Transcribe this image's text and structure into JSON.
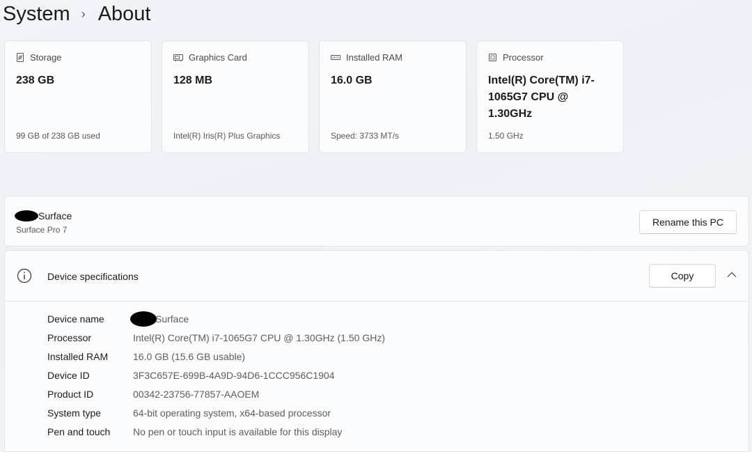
{
  "breadcrumb": {
    "parent": "System",
    "separator": "›",
    "current": "About"
  },
  "cards": [
    {
      "icon": "storage-icon",
      "label": "Storage",
      "value": "238 GB",
      "sub": "99 GB of 238 GB used"
    },
    {
      "icon": "graphics-card-icon",
      "label": "Graphics Card",
      "value": "128 MB",
      "sub": "Intel(R) Iris(R) Plus Graphics"
    },
    {
      "icon": "ram-icon",
      "label": "Installed RAM",
      "value": "16.0 GB",
      "sub": "Speed: 3733 MT/s"
    },
    {
      "icon": "processor-icon",
      "label": "Processor",
      "value": "Intel(R) Core(TM) i7-1065G7 CPU @ 1.30GHz",
      "sub": "1.50 GHz"
    }
  ],
  "pc": {
    "name_suffix": "Surface",
    "model": "Surface Pro 7",
    "rename_label": "Rename this PC"
  },
  "specs": {
    "title": "Device specifications",
    "copy_label": "Copy",
    "rows": [
      {
        "key": "Device name",
        "value": "Surface",
        "redacted": true
      },
      {
        "key": "Processor",
        "value": "Intel(R) Core(TM) i7-1065G7 CPU @ 1.30GHz (1.50 GHz)"
      },
      {
        "key": "Installed RAM",
        "value": "16.0 GB (15.6 GB usable)"
      },
      {
        "key": "Device ID",
        "value": "3F3C657E-699B-4A9D-94D6-1CCC956C1904"
      },
      {
        "key": "Product ID",
        "value": "00342-23756-77857-AAOEM"
      },
      {
        "key": "System type",
        "value": "64-bit operating system, x64-based processor"
      },
      {
        "key": "Pen and touch",
        "value": "No pen or touch input is available for this display"
      }
    ]
  }
}
